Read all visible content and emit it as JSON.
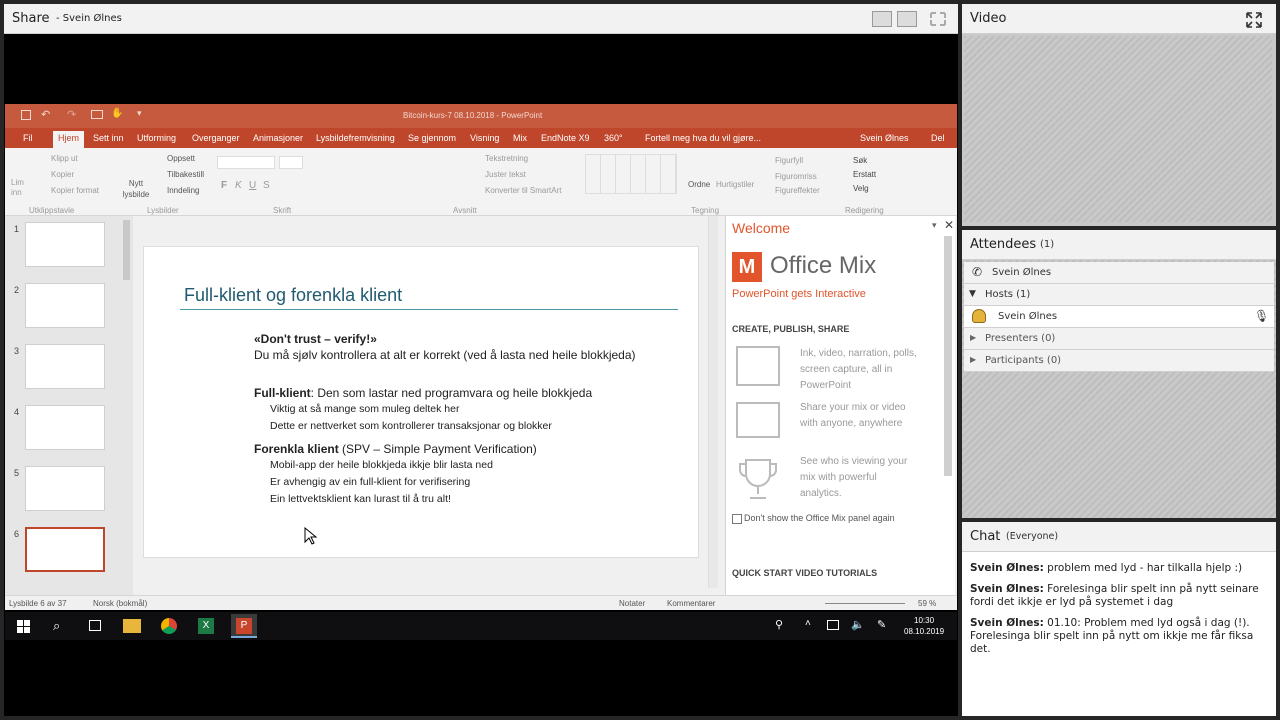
{
  "share": {
    "title": "Share",
    "presenter": "- Svein Ølnes"
  },
  "powerpoint": {
    "window_title": "Bitcoin-kurs-7 08.10.2018 - PowerPoint",
    "tabs": [
      "Fil",
      "Hjem",
      "Sett inn",
      "Utforming",
      "Overganger",
      "Animasjoner",
      "Lysbildefremvisning",
      "Se gjennom",
      "Visning",
      "Mix",
      "EndNote X9",
      "360°",
      "Fortell meg hva du vil gjøre..."
    ],
    "user": "Svein Ølnes",
    "share_label": "Del",
    "ribbon": {
      "paste": "Lim inn",
      "cut": "Klipp ut",
      "copy": "Kopier",
      "format": "Kopier format",
      "clipboard": "Utklippstavle",
      "new_slide_1": "Nytt",
      "new_slide_2": "lysbilde",
      "layout": "Oppsett",
      "reset": "Tilbakestill",
      "section": "Inndeling",
      "slides": "Lysbilder",
      "font": "Skrift",
      "text_dir": "Tekstretning",
      "align_text": "Juster tekst",
      "smartart": "Konverter til SmartArt",
      "paragraph": "Avsnitt",
      "arrange": "Ordne",
      "quick": "Hurtigstiler",
      "fill": "Figurfyll",
      "outline": "Figuromriss",
      "effects": "Figureffekter",
      "drawing": "Tegning",
      "find": "Søk",
      "replace": "Erstatt",
      "select": "Velg",
      "editing": "Redigering",
      "bold": "F",
      "italic": "K",
      "underline": "U",
      "strike": "S"
    },
    "thumbnails": [
      "1",
      "2",
      "3",
      "4",
      "5",
      "6"
    ],
    "status": {
      "slide": "Lysbilde 6 av 37",
      "lang": "Norsk (bokmål)",
      "notes": "Notater",
      "comments": "Kommentarer",
      "zoom": "59 %"
    }
  },
  "slide": {
    "title": "Full-klient og forenkla klient",
    "b1_bold": "«Don't trust – verify!»",
    "b1_text": "Du må sjølv kontrollera at alt er korrekt (ved å lasta ned heile blokkjeda)",
    "b2_bold": "Full-klient",
    "b2_text": ": Den som lastar ned programvara og heile blokkjeda",
    "b2_s1": "Viktig at så mange som muleg deltek her",
    "b2_s2": "Dette er nettverket som kontrollerer transaksjonar og blokker",
    "b3_bold": "Forenkla klient",
    "b3_text": " (SPV – Simple Payment Verification)",
    "b3_s1": "Mobil-app der heile blokkjeda ikkje blir lasta ned",
    "b3_s2": "Er avhengig av ein full-klient for verifisering",
    "b3_s3": "Ein lettvektsklient kan lurast til å tru alt!"
  },
  "mix": {
    "welcome": "Welcome",
    "brand": "Office Mix",
    "tagline": "PowerPoint gets Interactive",
    "section": "CREATE, PUBLISH, SHARE",
    "f1": "Ink, video, narration, polls, screen capture, all in PowerPoint",
    "f2": "Share your mix or video with anyone, anywhere",
    "f3": "See who is viewing your mix with powerful analytics.",
    "checkbox": "Don't show the Office Mix panel again",
    "quick": "QUICK START VIDEO TUTORIALS"
  },
  "taskbar": {
    "time": "10:30",
    "date": "08.10.2019"
  },
  "video": {
    "title": "Video"
  },
  "attendees": {
    "title": "Attendees",
    "count": "(1)",
    "me": "Svein Ølnes",
    "hosts": "Hosts (1)",
    "host_name": "Svein Ølnes",
    "presenters": "Presenters (0)",
    "participants": "Participants (0)"
  },
  "chat": {
    "title": "Chat",
    "scope": "(Everyone)",
    "messages": [
      {
        "sender": "Svein Ølnes:",
        "text": "problem med lyd - har tilkalla hjelp :)"
      },
      {
        "sender": "Svein Ølnes:",
        "text": "Forelesinga blir spelt inn på nytt seinare fordi det ikkje er lyd på systemet i dag"
      },
      {
        "sender": "Svein Ølnes:",
        "text": "01.10: Problem med lyd også i dag (!). Forelesinga blir spelt inn på nytt om ikkje me får fiksa det."
      }
    ]
  },
  "colors": {
    "ppt_red": "#c0462b",
    "mix_orange": "#e2542b",
    "slide_title": "#1f5a6e"
  }
}
